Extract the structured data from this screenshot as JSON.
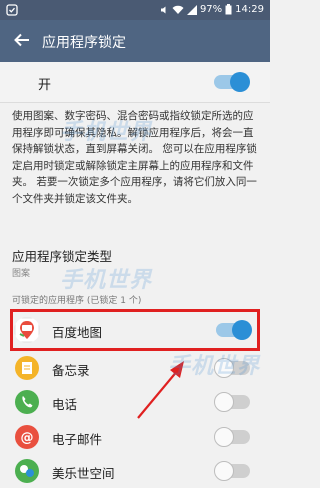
{
  "status_bar": {
    "battery": "97%",
    "time": "14:29"
  },
  "header": {
    "title": "应用程序锁定"
  },
  "master_switch": {
    "label": "开",
    "on": true
  },
  "description": "使用图案、数字密码、混合密码或指纹锁定所选的应用程序即可确保其隐私。解锁应用程序后，将会一直保持解锁状态，直到屏幕关闭。 您可以在应用程序锁定启用时锁定或解除锁定主屏幕上的应用程序和文件夹。 若要一次锁定多个应用程序，请将它们放入同一个文件夹并锁定该文件夹。",
  "lock_type": {
    "title": "应用程序锁定类型",
    "value": "图案"
  },
  "apps_header": "可锁定的应用程序 (已锁定 1 个)",
  "apps": [
    {
      "name": "百度地图",
      "icon": "baidu-map-icon",
      "locked": true
    },
    {
      "name": "备忘录",
      "icon": "memo-icon",
      "locked": false
    },
    {
      "name": "电话",
      "icon": "phone-icon",
      "locked": false
    },
    {
      "name": "电子邮件",
      "icon": "email-icon",
      "locked": false
    },
    {
      "name": "美乐世空间",
      "icon": "app-icon",
      "locked": false
    }
  ],
  "watermark": {
    "text1": "手机世界",
    "text2": "手机世界",
    "text3": "手机世界"
  },
  "colors": {
    "accent": "#2b8fd6",
    "appbar": "#4f6582",
    "highlight": "#e02020"
  }
}
